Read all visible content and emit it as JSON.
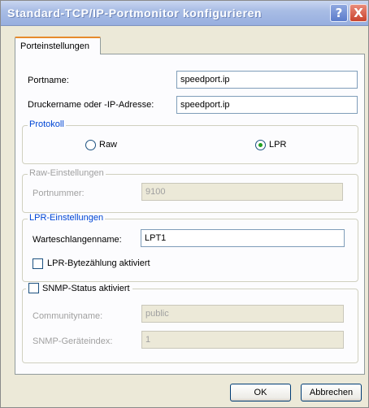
{
  "window": {
    "title": "Standard-TCP/IP-Portmonitor konfigurieren"
  },
  "titlebar_buttons": {
    "help": "?",
    "close": "X"
  },
  "tabs": [
    {
      "label": "Porteinstellungen"
    }
  ],
  "port_name": {
    "label": "Portname:",
    "value": "speedport.ip"
  },
  "printer_name": {
    "label": "Druckername oder -IP-Adresse:",
    "value": "speedport.ip"
  },
  "protocol": {
    "title": "Protokoll",
    "raw_label": "Raw",
    "lpr_label": "LPR",
    "selected": "LPR"
  },
  "raw_settings": {
    "title": "Raw-Einstellungen",
    "port_number_label": "Portnummer:",
    "port_number_value": "9100"
  },
  "lpr_settings": {
    "title": "LPR-Einstellungen",
    "queue_label": "Warteschlangenname:",
    "queue_value": "LPT1",
    "byte_count_label": "LPR-Bytezählung aktiviert",
    "byte_count_checked": false
  },
  "snmp": {
    "title": "SNMP-Status aktiviert",
    "enabled": false,
    "community_label": "Communityname:",
    "community_value": "public",
    "device_index_label": "SNMP-Geräteindex:",
    "device_index_value": "1"
  },
  "buttons": {
    "ok": "OK",
    "cancel": "Abbrechen"
  },
  "colors": {
    "tab_accent": "#e68b2c",
    "group_title": "#0046d5",
    "radio_selected": "#21a121"
  }
}
